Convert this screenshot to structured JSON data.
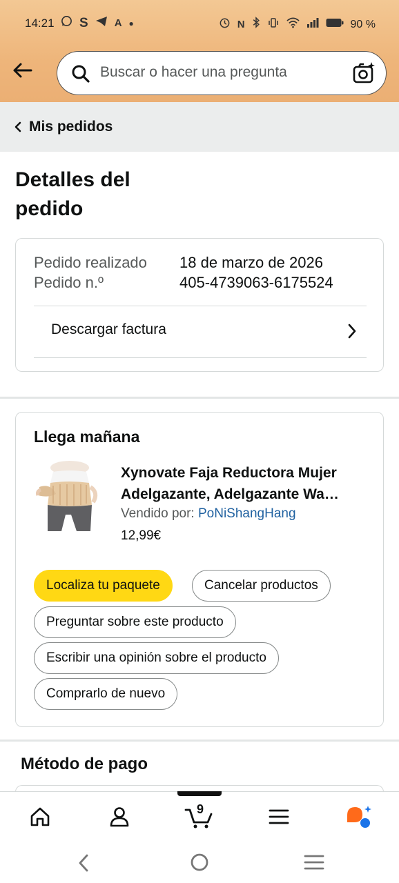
{
  "status_bar": {
    "time": "14:21",
    "battery": "90 %"
  },
  "search": {
    "placeholder": "Buscar o hacer una pregunta"
  },
  "breadcrumb": {
    "label": "Mis pedidos"
  },
  "page": {
    "title_line1": "Detalles del",
    "title_line2": "pedido"
  },
  "order": {
    "placed_label": "Pedido realizado",
    "placed_value": "18 de marzo de 2026",
    "number_label": "Pedido n.º",
    "number_value": "405-4739063-6175524",
    "invoice_label": "Descargar factura"
  },
  "delivery": {
    "title": "Llega mañana",
    "product_title_line1": "Xynovate Faja Reductora Mujer",
    "product_title_line2": "Adelgazante, Adelgazante Wa…",
    "seller_prefix": "Vendido por: ",
    "seller_name": "PoNiShangHang",
    "price": "12,99€",
    "buttons": {
      "track": "Localiza tu paquete",
      "cancel": "Cancelar productos",
      "ask": "Preguntar sobre este producto",
      "review": "Escribir una opinión sobre el producto",
      "buy_again": "Comprarlo de nuevo"
    }
  },
  "payment": {
    "title": "Método de pago"
  },
  "bottom_nav": {
    "cart_count": "9",
    "items": [
      "home-icon",
      "account-icon",
      "cart-icon",
      "menu-icon",
      "rufus-icon"
    ]
  },
  "colors": {
    "header_bg": "#f3c894",
    "primary_button": "#ffd814",
    "link": "#2162a1",
    "breadcrumb_bg": "#ebeded"
  }
}
